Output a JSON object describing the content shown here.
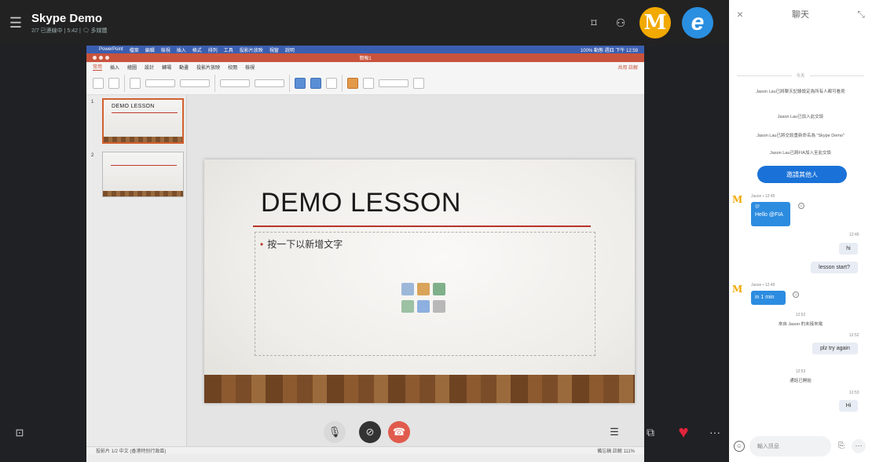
{
  "call": {
    "title": "Skype Demo",
    "subtitle": "2/7 已連線中 | 5:42 | 🗨 多媒體"
  },
  "header_icons": {
    "layout": "⌑",
    "participants": "⚇"
  },
  "avatars": {
    "mcdonalds_initial": "M",
    "ie_initial": "e"
  },
  "powerpoint": {
    "menubar": [
      "PowerPoint",
      "檔案",
      "編輯",
      "檢視",
      "插入",
      "格式",
      "排列",
      "工具",
      "投影片放映",
      "視窗",
      "說明"
    ],
    "menubar_right": "100% 動態  週四 下午 12:59",
    "doc_title": "簡報1",
    "tabs": [
      "常用",
      "插入",
      "繪圖",
      "設計",
      "轉場",
      "動畫",
      "投影片放映",
      "校閱",
      "檢視"
    ],
    "share_label": "共用  註解",
    "slides": [
      {
        "number": "1",
        "title": "DEMO LESSON"
      },
      {
        "number": "2",
        "title": ""
      }
    ],
    "slide_title": "DEMO LESSON",
    "bullet_text": "按一下以新增文字",
    "status_left": "投影片 1/2    中文 (香港特別行政區)",
    "status_right": "備忘稿   註解   111%"
  },
  "controls": {
    "mic_icon": "🎙",
    "video_icon": "⊘",
    "end_icon": "☎",
    "chat_icon": "☰",
    "share_icon": "⧉",
    "heart_icon": "♥",
    "more_icon": "···",
    "snapshot_icon": "⊡"
  },
  "chat": {
    "title": "聊天",
    "close_icon": "×",
    "expand_icon": "⤡",
    "day_label": "今天",
    "system_messages": [
      "Jason Lau已將聊天記錄設定為所有人都可看見",
      "Jason Lau已加入此交談",
      "Jason Lau已將交談重新命名為 \"Skype Demo\"",
      "Jason Lau已將FIA加入至此交談"
    ],
    "invite_label": "邀請其他人",
    "messages": {
      "m1_meta": "Jason • 12:45",
      "m1_mention": "@",
      "m1_text": "Hello @FIA",
      "m2_time": "12:45",
      "m2_text": "hi",
      "m3_text": "lesson start?",
      "m4_meta": "Jason • 12:49",
      "m4_text": "in 1 min",
      "m5_time": "12:52",
      "m5_text": "來自 Jason 的未接來電",
      "m6_time": "12:52",
      "m6_text": "plz try again",
      "m7_time": "12:53",
      "m7_text": "通話已開始",
      "m8_time": "12:53",
      "m8_text": "Hi"
    },
    "reaction_icon": "☺",
    "input_placeholder": "輸入訊息",
    "emoji_icon": "☺",
    "attach_icon": "⎘",
    "more_icon": "···"
  }
}
